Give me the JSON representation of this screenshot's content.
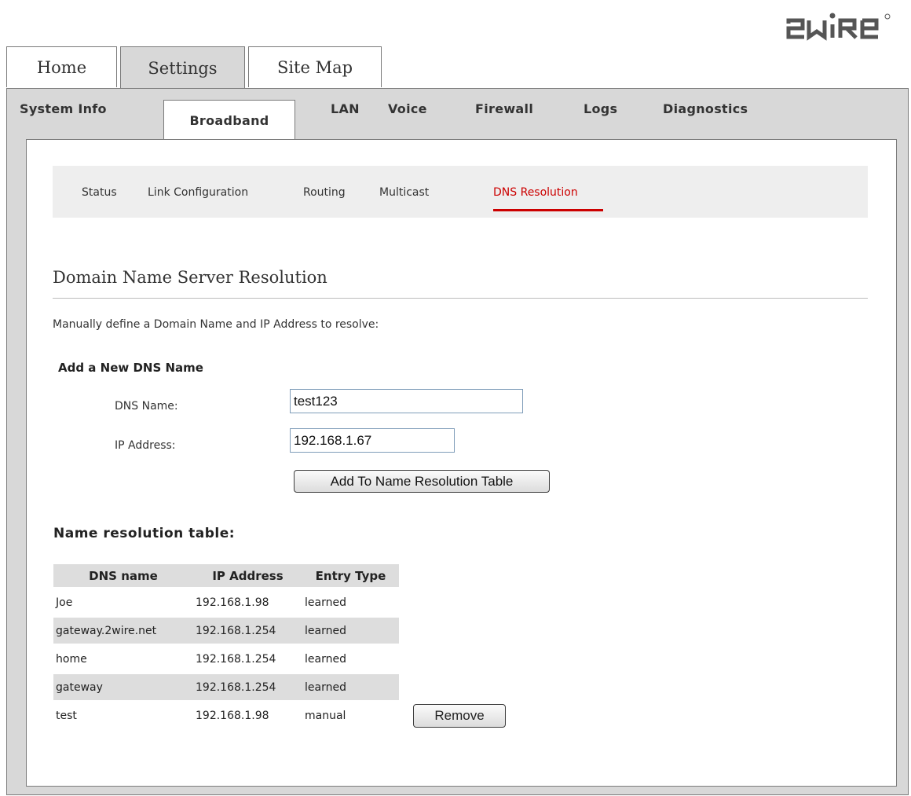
{
  "brand": {
    "logo_text": "2wire"
  },
  "top_tabs": [
    {
      "label": "Home"
    },
    {
      "label": "Settings"
    },
    {
      "label": "Site Map"
    }
  ],
  "sub_tabs": [
    {
      "label": "System Info"
    },
    {
      "label": "Broadband"
    },
    {
      "label": "LAN"
    },
    {
      "label": "Voice"
    },
    {
      "label": "Firewall"
    },
    {
      "label": "Logs"
    },
    {
      "label": "Diagnostics"
    }
  ],
  "third_nav": [
    {
      "label": "Status"
    },
    {
      "label": "Link Configuration"
    },
    {
      "label": "Routing"
    },
    {
      "label": "Multicast"
    },
    {
      "label": "DNS Resolution"
    }
  ],
  "page": {
    "title": "Domain Name Server Resolution",
    "intro": "Manually define a Domain Name and IP Address to resolve:"
  },
  "form": {
    "heading": "Add a New DNS Name",
    "dns_label": "DNS Name:",
    "dns_value": "test123",
    "ip_label": "IP Address:",
    "ip_value": "192.168.1.67",
    "submit_label": "Add To Name Resolution Table"
  },
  "table": {
    "heading": "Name resolution table:",
    "columns": [
      "DNS name",
      "IP Address",
      "Entry Type"
    ],
    "rows": [
      {
        "name": "Joe",
        "ip": "192.168.1.98",
        "type": "learned"
      },
      {
        "name": "gateway.2wire.net",
        "ip": "192.168.1.254",
        "type": "learned"
      },
      {
        "name": "home",
        "ip": "192.168.1.254",
        "type": "learned"
      },
      {
        "name": "gateway",
        "ip": "192.168.1.254",
        "type": "learned"
      },
      {
        "name": "test",
        "ip": "192.168.1.98",
        "type": "manual",
        "action": "Remove"
      }
    ]
  }
}
